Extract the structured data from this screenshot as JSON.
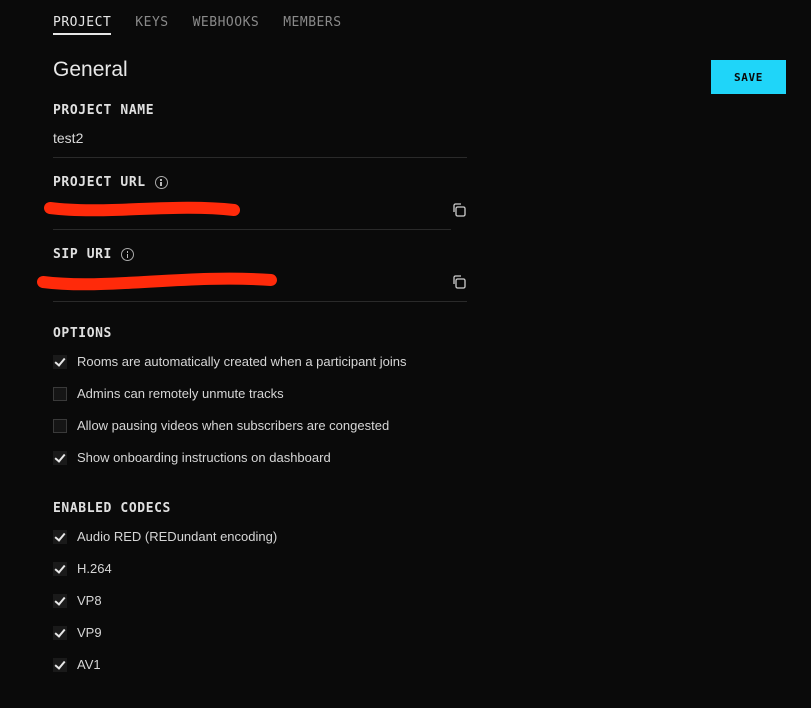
{
  "tabs": [
    {
      "label": "PROJECT",
      "active": true
    },
    {
      "label": "KEYS",
      "active": false
    },
    {
      "label": "WEBHOOKS",
      "active": false
    },
    {
      "label": "MEMBERS",
      "active": false
    }
  ],
  "page_title": "General",
  "save_label": "SAVE",
  "accent_color": "#1fd5f9",
  "fields": {
    "project_name": {
      "label": "PROJECT NAME",
      "value": "test2"
    },
    "project_url": {
      "label": "PROJECT URL",
      "value": "",
      "redacted": true
    },
    "sip_uri": {
      "label": "SIP URI",
      "value": "",
      "redacted": true
    }
  },
  "options": {
    "heading": "OPTIONS",
    "items": [
      {
        "label": "Rooms are automatically created when a participant joins",
        "checked": true
      },
      {
        "label": "Admins can remotely unmute tracks",
        "checked": false
      },
      {
        "label": "Allow pausing videos when subscribers are congested",
        "checked": false
      },
      {
        "label": "Show onboarding instructions on dashboard",
        "checked": true
      }
    ]
  },
  "codecs": {
    "heading": "ENABLED CODECS",
    "items": [
      {
        "label": "Audio RED (REDundant encoding)",
        "checked": true
      },
      {
        "label": "H.264",
        "checked": true
      },
      {
        "label": "VP8",
        "checked": true
      },
      {
        "label": "VP9",
        "checked": true
      },
      {
        "label": "AV1",
        "checked": true
      }
    ]
  }
}
